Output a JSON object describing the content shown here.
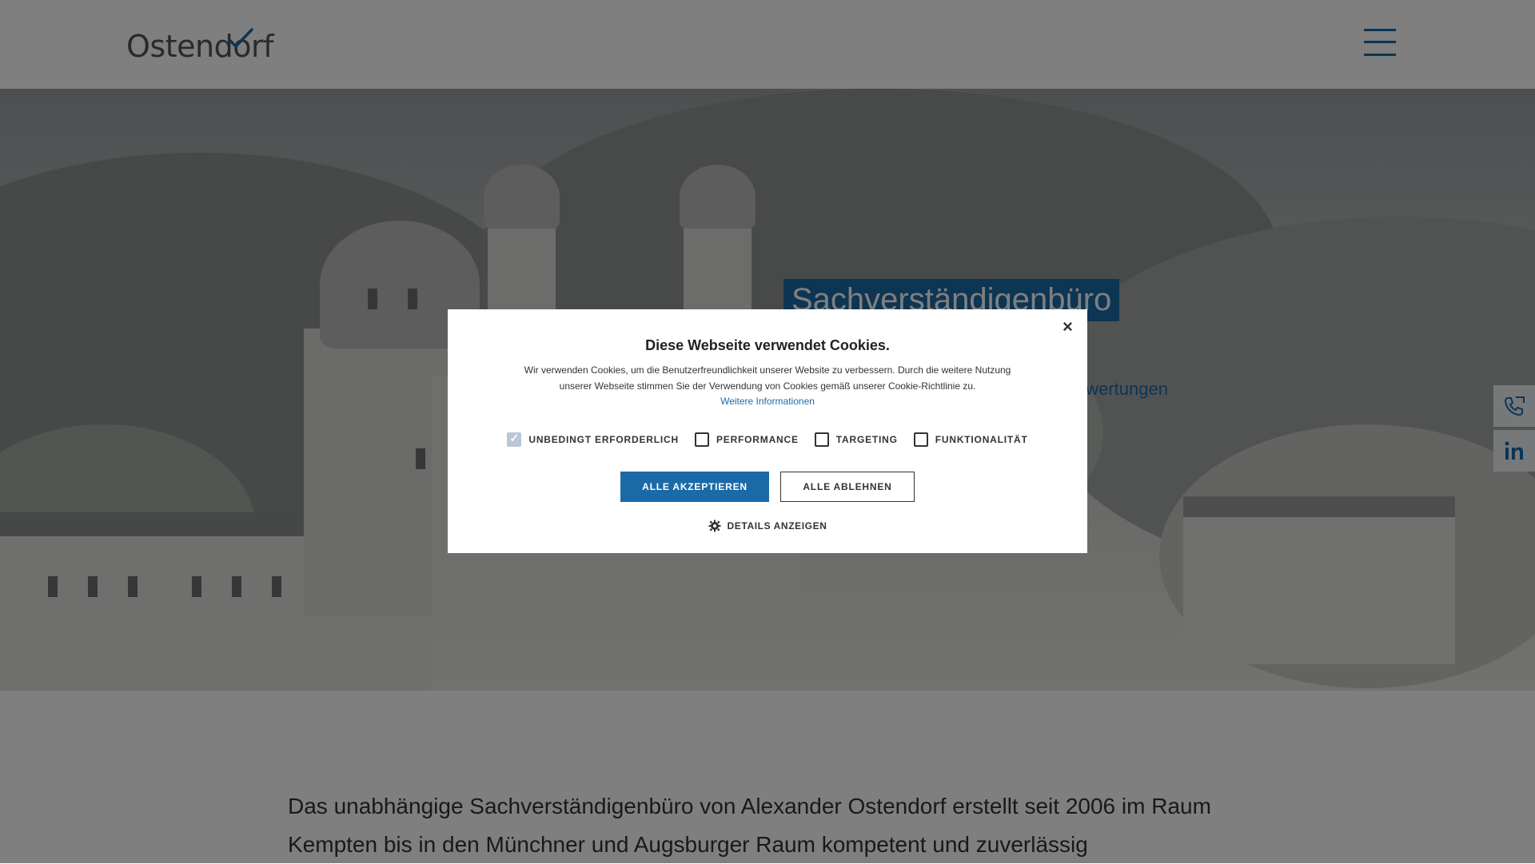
{
  "header": {
    "logo_text": "Ostendorf",
    "menu_icon": "hamburger-menu-icon"
  },
  "hero": {
    "title": "Sachverständigenbüro",
    "subtitle": "ewertungen"
  },
  "side_buttons": {
    "phone_icon": "phone-icon",
    "linkedin_icon": "linkedin-icon"
  },
  "intro": {
    "text": "Das unabhängige Sachverständigenbüro von Alexander Ostendorf erstellt seit 2006 im Raum Kempten bis in den Münchner und Augsburger Raum kompetent und zuverlässig"
  },
  "cookie_dialog": {
    "close": "×",
    "title": "Diese Webseite verwendet Cookies.",
    "text": "Wir verwenden Cookies, um die Benutzerfreundlichkeit unserer Website zu verbessern. Durch die weitere Nutzung unserer Webseite stimmen Sie der Verwendung von Cookies gemäß unserer Cookie-Richtlinie zu.",
    "more_link": "Weitere Informationen",
    "checkboxes": [
      {
        "label": "UNBEDINGT ERFORDERLICH",
        "checked": true,
        "disabled": true
      },
      {
        "label": "PERFORMANCE",
        "checked": false,
        "disabled": false
      },
      {
        "label": "TARGETING",
        "checked": false,
        "disabled": false
      },
      {
        "label": "FUNKTIONALITÄT",
        "checked": false,
        "disabled": false
      }
    ],
    "accept_label": "ALLE AKZEPTIEREN",
    "decline_label": "ALLE ABLEHNEN",
    "details_label": "DETAILS ANZEIGEN"
  },
  "colors": {
    "brand_blue": "#1b6aa8",
    "overlay": "rgba(0,0,0,0.5)"
  }
}
